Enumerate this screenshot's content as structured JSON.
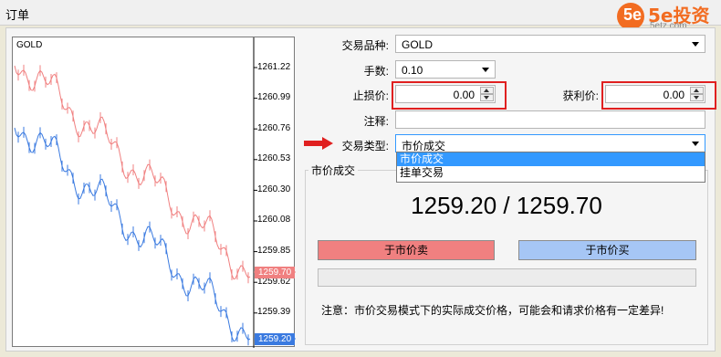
{
  "window": {
    "title": "订单"
  },
  "logo": {
    "badge": "5e",
    "brand": "5e投资",
    "url": "5etz.com"
  },
  "chart": {
    "symbol": "GOLD",
    "ticks": [
      "1261.22",
      "1260.99",
      "1260.76",
      "1260.53",
      "1260.30",
      "1260.08",
      "1259.85",
      "1259.62",
      "1259.39"
    ],
    "ask_tag": "1259.70",
    "bid_tag": "1259.20",
    "ask_color": "#f08080",
    "bid_color": "#3a7ae0"
  },
  "form": {
    "symbol_label": "交易品种:",
    "symbol_value": "GOLD",
    "volume_label": "手数:",
    "volume_value": "0.10",
    "stoploss_label": "止损价:",
    "stoploss_value": "0.00",
    "takeprofit_label": "获利价:",
    "takeprofit_value": "0.00",
    "comment_label": "注释:",
    "comment_value": "",
    "type_label": "交易类型:",
    "type_value": "市价成交",
    "type_options": [
      "市价成交",
      "挂单交易"
    ]
  },
  "market": {
    "group_title": "市价成交",
    "quote": "1259.20 / 1259.70",
    "sell_button": "于市价卖",
    "buy_button": "于市价买",
    "notice": "注意：市价交易模式下的实际成交价格，可能会和请求价格有一定差异!"
  }
}
